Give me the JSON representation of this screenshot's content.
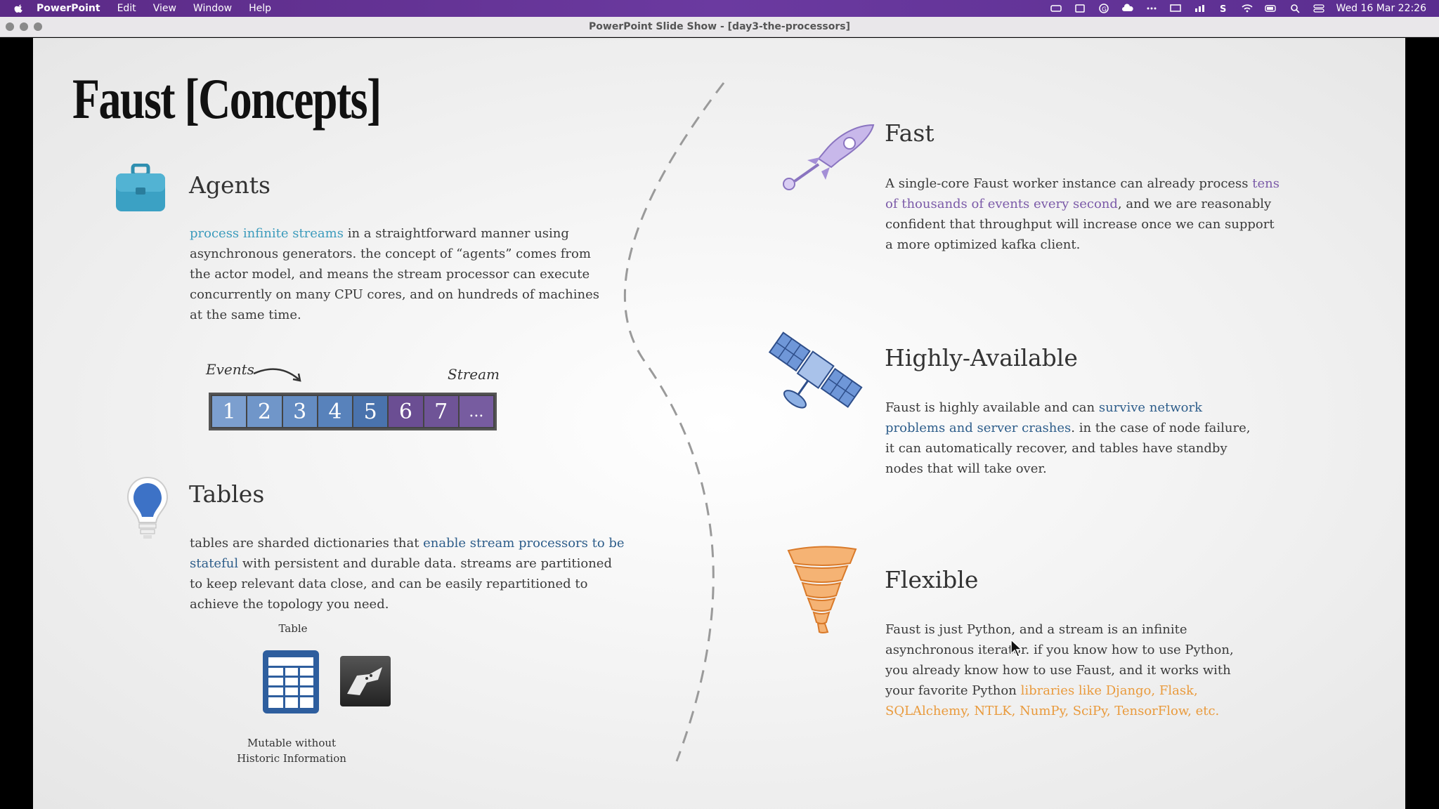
{
  "menubar": {
    "items": [
      "PowerPoint",
      "Edit",
      "View",
      "Window",
      "Help"
    ],
    "clock": "Wed 16 Mar  22:26"
  },
  "window": {
    "title": "PowerPoint Slide Show - [day3-the-processors]"
  },
  "slide": {
    "title": "Faust [Concepts]",
    "agents": {
      "heading": "Agents",
      "highlight": "process infinite streams",
      "body": " in a straightforward manner using asynchronous generators. the concept of “agents” comes from the actor model, and means the stream processor can execute concurrently on many CPU cores, and on hundreds of machines at the same time."
    },
    "stream_diagram": {
      "events_label": "Events",
      "stream_label": "Stream",
      "cells": [
        "1",
        "2",
        "3",
        "4",
        "5",
        "6",
        "7",
        "..."
      ]
    },
    "tables": {
      "heading": "Tables",
      "pre": "tables are sharded dictionaries that ",
      "highlight": "enable stream processors to be stateful",
      "post": " with persistent and durable data. streams are partitioned to keep relevant data close, and can be easily repartitioned to achieve the topology you need.",
      "table_label": "Table",
      "table_caption_1": "Mutable without",
      "table_caption_2": "Historic Information"
    },
    "fast": {
      "heading": "Fast",
      "pre": "A single-core Faust worker instance can already process ",
      "highlight": "tens of thousands of events every second",
      "post": ", and we are reasonably confident that throughput will increase once we can support a more optimized kafka client."
    },
    "ha": {
      "heading": "Highly-Available",
      "pre": "Faust is highly available and can ",
      "highlight": "survive network problems and server crashes",
      "post": ". in the case of node failure, it can automatically recover, and tables have standby nodes that will take over."
    },
    "flexible": {
      "heading": "Flexible",
      "pre": "Faust is just Python, and a stream is an infinite asynchronous iterator. if you know how to use Python, you already know how to use Faust, and it works with your favorite Python ",
      "highlight": "libraries like Django, Flask, SQLAlchemy, NTLK, NumPy, SciPy, TensorFlow, etc."
    }
  },
  "colors": {
    "teal": "#3c9bbc",
    "blue": "#2d5d8a",
    "purple": "#7b5aa8",
    "orange": "#e99a3c"
  }
}
